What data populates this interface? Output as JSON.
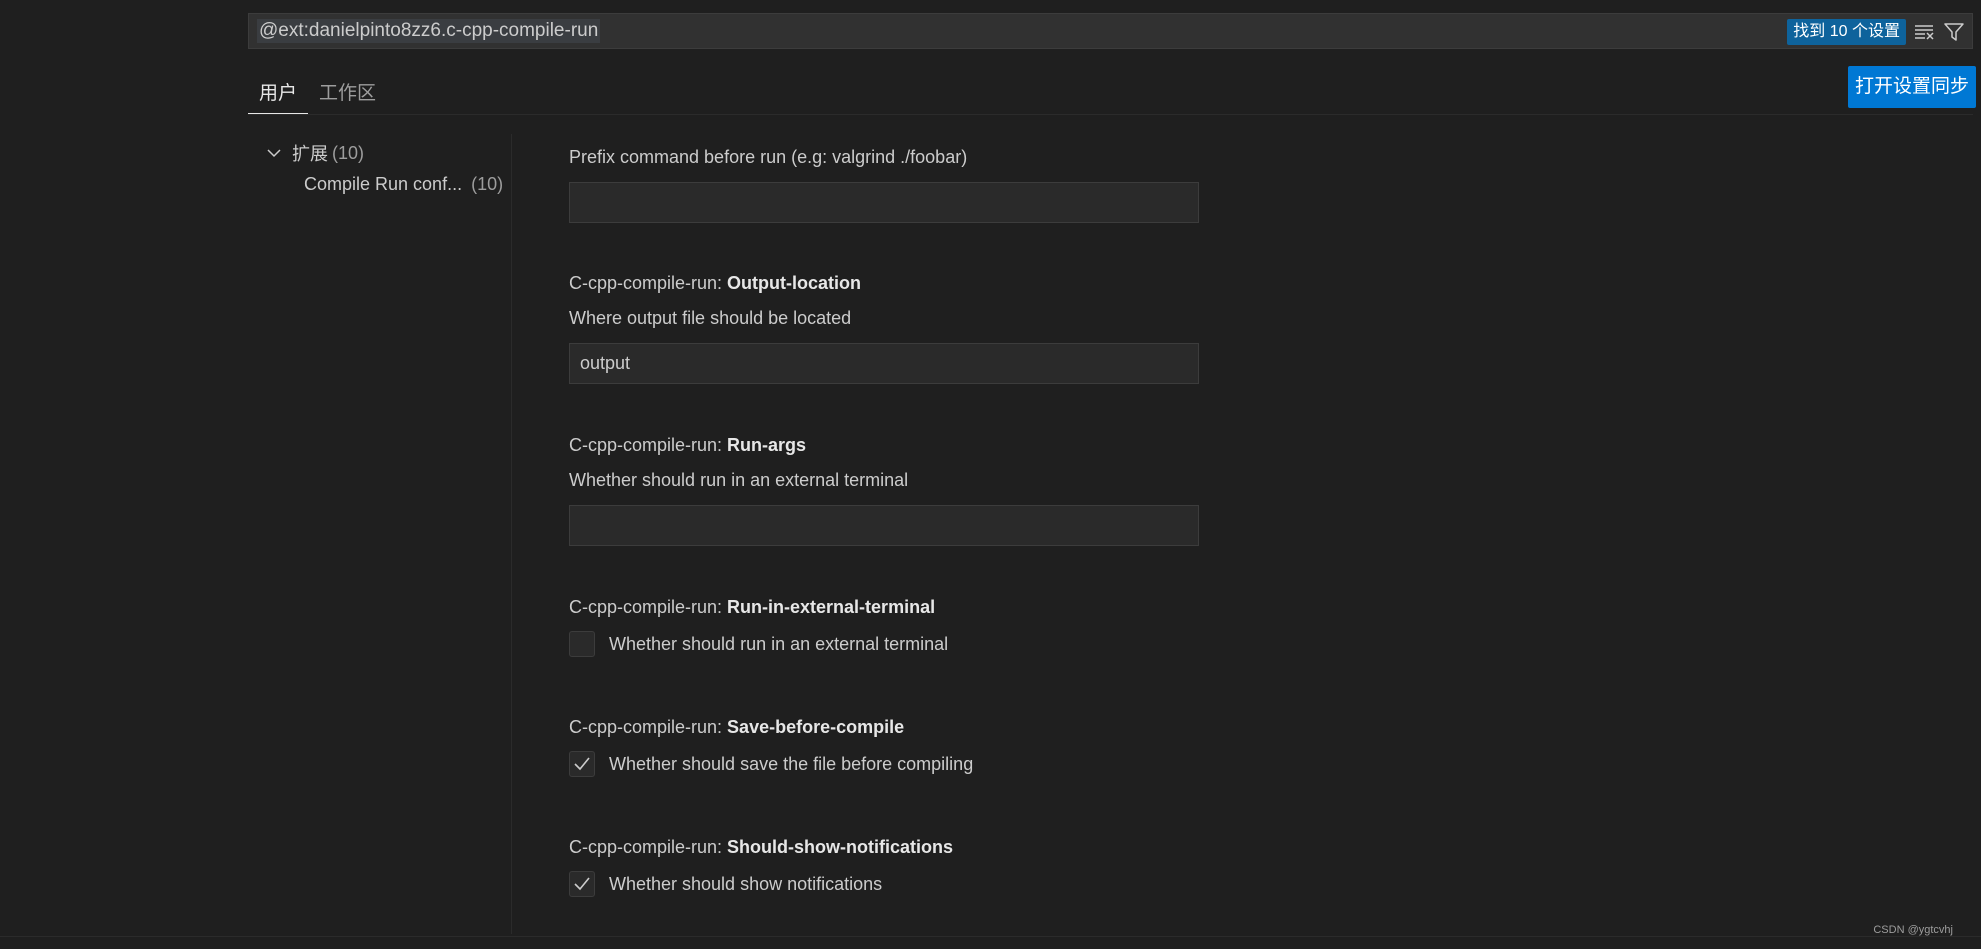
{
  "search": {
    "query": "@ext:danielpinto8zz6.c-cpp-compile-run",
    "result_count": "找到 10 个设置"
  },
  "tabs": [
    {
      "label": "用户"
    },
    {
      "label": "工作区"
    }
  ],
  "sync_button": "打开设置同步",
  "toc": {
    "group_label": "扩展",
    "group_count": "(10)",
    "item_label": "Compile Run conf...",
    "item_count": "(10)"
  },
  "settings": {
    "run_prefix": {
      "description": "Prefix command before run (e.g: valgrind ./foobar)",
      "value": ""
    },
    "output_location": {
      "prefix": "C-cpp-compile-run: ",
      "key": "Output-location",
      "description": "Where output file should be located",
      "value": "output"
    },
    "run_args": {
      "prefix": "C-cpp-compile-run: ",
      "key": "Run-args",
      "description": "Whether should run in an external terminal",
      "value": ""
    },
    "run_in_external_terminal": {
      "prefix": "C-cpp-compile-run: ",
      "key": "Run-in-external-terminal",
      "description": "Whether should run in an external terminal",
      "checked": false
    },
    "save_before_compile": {
      "prefix": "C-cpp-compile-run: ",
      "key": "Save-before-compile",
      "description": "Whether should save the file before compiling",
      "checked": true
    },
    "should_show_notifications": {
      "prefix": "C-cpp-compile-run: ",
      "key": "Should-show-notifications",
      "description": "Whether should show notifications",
      "checked": true
    }
  },
  "watermark": "CSDN @ygtcvhj",
  "colors": {
    "background": "#1f1f1f",
    "accent": "#0078d4",
    "badge": "#0e639c"
  }
}
